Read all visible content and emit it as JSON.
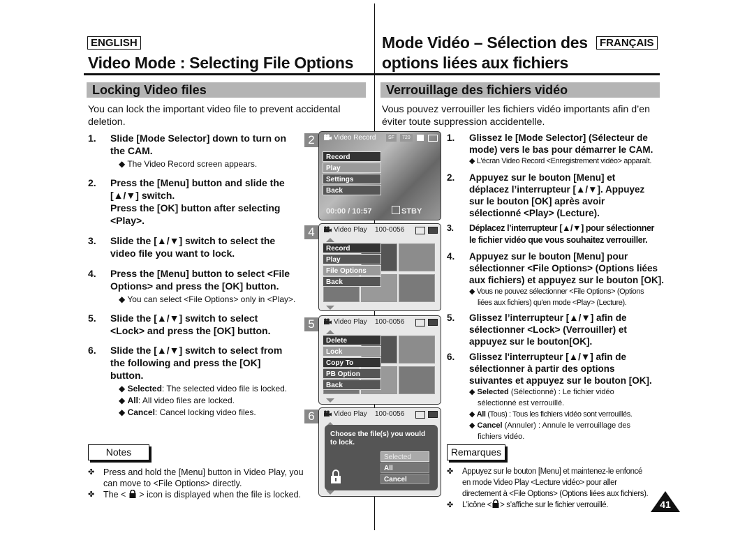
{
  "english": {
    "lang_tag": "ENGLISH",
    "title": "Video Mode : Selecting File Options",
    "section": "Locking Video files",
    "intro": [
      "You can lock the important video file to prevent accidental",
      "deletion."
    ],
    "steps": [
      {
        "num": "1.",
        "lines": [
          "Slide [Mode Selector] down to turn on",
          "the CAM."
        ],
        "subs": [
          "◆ The Video Record screen appears."
        ]
      },
      {
        "num": "2.",
        "lines": [
          "Press the [Menu] button and slide the",
          "[▲/▼] switch.",
          "Press the [OK] button after selecting",
          "<Play>."
        ],
        "subs": []
      },
      {
        "num": "3.",
        "lines": [
          "Slide the [▲/▼] switch to select the",
          "video file you want to lock."
        ],
        "subs": []
      },
      {
        "num": "4.",
        "lines": [
          "Press the [Menu] button to select <File",
          "Options> and press the [OK] button."
        ],
        "subs": [
          "◆ You can select <File Options> only in <Play>."
        ]
      },
      {
        "num": "5.",
        "lines": [
          "Slide the [▲/▼] switch to select",
          "<Lock> and press the [OK] button."
        ],
        "subs": []
      },
      {
        "num": "6.",
        "lines": [
          "Slide the [▲/▼] switch to select from",
          "the following and press the [OK]",
          "button."
        ],
        "subs": [
          {
            "term": "Selected",
            "desc": ": The selected video file is locked."
          },
          {
            "term": "All",
            "desc": ": All video files are locked."
          },
          {
            "term": "Cancel",
            "desc": ": Cancel locking video files."
          }
        ]
      }
    ],
    "notes_label": "Notes",
    "notes": [
      [
        "Press and hold the [Menu] button in Video Play, you",
        "can move to <File Options> directly."
      ],
      [
        "The <",
        "> icon is displayed when the file is locked."
      ]
    ]
  },
  "french": {
    "lang_tag": "FRANÇAIS",
    "title_line1": "Mode Vidéo – Sélection des",
    "title_line2": "options liées aux fichiers",
    "section": "Verrouillage des fichiers vidéo",
    "intro": [
      "Vous pouvez verrouiller les fichiers vidéo importants afin d’en",
      "éviter toute suppression accidentelle."
    ],
    "steps": [
      {
        "num": "1.",
        "lines": [
          "Glissez le [Mode Selector] (Sélecteur de",
          "mode) vers le bas pour démarrer le CAM."
        ],
        "subs": [
          "◆ L'écran Video Record <Enregistrement vidéo> apparaît."
        ]
      },
      {
        "num": "2.",
        "lines": [
          "Appuyez sur le bouton [Menu] et",
          "déplacez l’interrupteur [▲/▼]. Appuyez",
          "sur le bouton [OK] après avoir",
          "sélectionné <Play> (Lecture)."
        ],
        "subs": []
      },
      {
        "num": "3.",
        "lines": [
          "Déplacez l’interrupteur [▲/▼] pour sélectionner",
          "le fichier vidéo que vous souhaitez verrouiller."
        ],
        "subs": []
      },
      {
        "num": "4.",
        "lines": [
          "Appuyez sur le bouton [Menu] pour",
          "sélectionner <File Options> (Options liées",
          "aux fichiers) et appuyez sur le bouton [OK]."
        ],
        "subs": [
          "◆ Vous ne pouvez sélectionner <File Options> (Options",
          "liées aux fichiers) qu'en mode <Play> (Lecture)."
        ]
      },
      {
        "num": "5.",
        "lines": [
          "Glissez l’interrupteur [▲/▼] afin de",
          "sélectionner <Lock> (Verrouiller) et",
          "appuyez sur le bouton[OK]."
        ],
        "subs": []
      },
      {
        "num": "6.",
        "lines": [
          "Glissez l'interrupteur [▲/▼] afin de",
          "sélectionner à partir des options",
          "suivantes et appuyez sur le bouton [OK]."
        ],
        "subs": [
          {
            "term": "Selected",
            "desc": " (Sélectionné) : Le fichier vidéo",
            "cont": "sélectionné est verrouillé."
          },
          {
            "term": "All",
            "desc": " (Tous) : Tous les fichiers vidéo sont verrouillés."
          },
          {
            "term": "Cancel",
            "desc": " (Annuler) : Annule le verrouillage des",
            "cont": "fichiers  vidéo."
          }
        ]
      }
    ],
    "notes_label": "Remarques",
    "notes": [
      [
        "Appuyez sur le bouton [Menu] et maintenez-le enfoncé",
        "en mode Video Play <Lecture vidéo> pour aller",
        "directement à <File Options> (Options liées aux fichiers)."
      ],
      [
        "L’icône <",
        "> s’affiche sur le fichier verrouillé."
      ]
    ]
  },
  "screens": [
    {
      "step": "2",
      "header": "Video Record",
      "badges": [
        "SF",
        "720"
      ],
      "menu": [
        "Record",
        "Play",
        "Settings",
        "Back"
      ],
      "highlight": "Play",
      "footer": {
        "time": "00:00 / 10:57",
        "status": "STBY"
      }
    },
    {
      "step": "4",
      "header": "Video Play",
      "file": "100-0056",
      "menu": [
        "Record",
        "Play",
        "File Options",
        "Back"
      ],
      "highlight": "File Options"
    },
    {
      "step": "5",
      "header": "Video Play",
      "file": "100-0056",
      "menu": [
        "Delete",
        "Lock",
        "Copy To",
        "PB Option",
        "Back"
      ],
      "highlight": "Lock"
    },
    {
      "step": "6",
      "header": "Video Play",
      "file": "100-0056",
      "dialog": "Choose the file(s) you would to lock.",
      "dialog_lines": [
        "Choose the file(s) you would",
        "to lock."
      ],
      "options": [
        "Selected",
        "All",
        "Cancel"
      ],
      "highlight": "Selected"
    }
  ],
  "page_number": "41",
  "icons": {
    "bullet": "✤",
    "lock": "lock-icon",
    "camera": "video-camera-icon",
    "battery": "battery-icon"
  }
}
